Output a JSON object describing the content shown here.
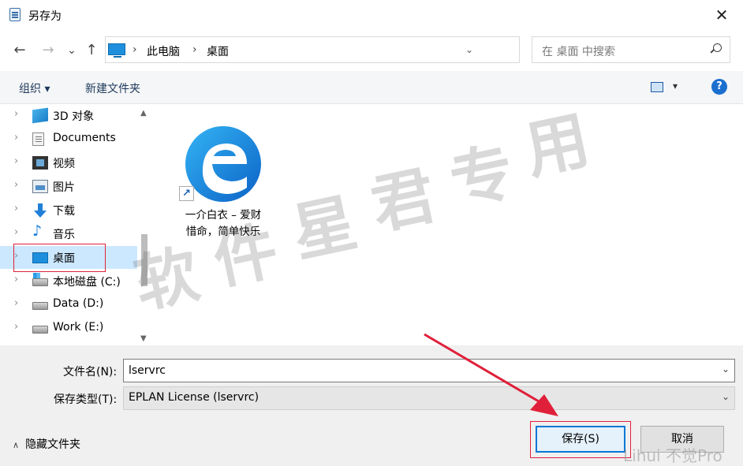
{
  "window": {
    "title": "另存为",
    "close_glyph": "✕"
  },
  "address": {
    "back_glyph": "←",
    "forward_glyph": "→",
    "recent_glyph": "⌄",
    "up_glyph": "↑",
    "crumbs": [
      "此电脑",
      "桌面"
    ],
    "sep_glyph": "›",
    "dropdown_glyph": "⌄",
    "refresh_glyph": "↻"
  },
  "search": {
    "placeholder": "在 桌面 中搜索"
  },
  "toolbar": {
    "organize_label": "组织 ▾",
    "new_folder_label": "新建文件夹",
    "view_dd": "▾",
    "help_label": "?"
  },
  "nav": {
    "items": [
      {
        "label": "3D 对象",
        "icon": "3d-objects-icon"
      },
      {
        "label": "Documents",
        "icon": "documents-icon"
      },
      {
        "label": "视频",
        "icon": "video-icon"
      },
      {
        "label": "图片",
        "icon": "pictures-icon"
      },
      {
        "label": "下载",
        "icon": "download-icon"
      },
      {
        "label": "音乐",
        "icon": "music-icon"
      },
      {
        "label": "桌面",
        "icon": "desktop-icon",
        "selected": true
      },
      {
        "label": "本地磁盘 (C:)",
        "icon": "os-drive-icon"
      },
      {
        "label": "Data (D:)",
        "icon": "drive-icon"
      },
      {
        "label": "Work (E:)",
        "icon": "drive-icon"
      }
    ],
    "chevron": "›",
    "music_glyph": "♪",
    "scroll_up": "▲",
    "scroll_down": "▼"
  },
  "files": [
    {
      "label_line1": "一介白衣 – 爱财",
      "label_line2": "惜命，简单快乐",
      "icon": "edge-shortcut-icon"
    }
  ],
  "watermark": {
    "chars": [
      "软",
      "件",
      "星",
      "君",
      "专",
      "用"
    ],
    "corner": "Lihui 不觉Pro"
  },
  "form": {
    "filename_label": "文件名(N):",
    "filename_value": "lservrc",
    "filetype_label": "保存类型(T):",
    "filetype_value": "EPLAN License (lservrc)",
    "dd_glyph": "⌄",
    "hide_folders_label": "隐藏文件夹",
    "hide_chev": "∧",
    "save_label": "保存(S)",
    "cancel_label": "取消"
  },
  "colors": {
    "accent": "#0078d7",
    "selection": "#cce8ff",
    "annotation_red": "#e0203a"
  }
}
